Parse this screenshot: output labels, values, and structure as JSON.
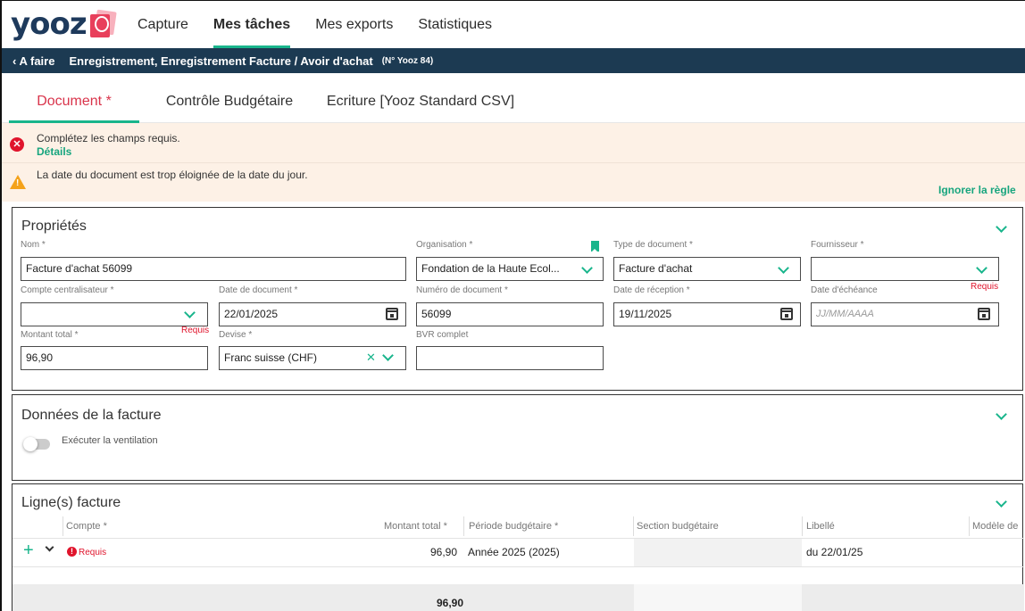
{
  "app": {
    "logo_text": "yooz",
    "nav": [
      {
        "label": "Capture",
        "active": false
      },
      {
        "label": "Mes tâches",
        "active": true
      },
      {
        "label": "Mes exports",
        "active": false
      },
      {
        "label": "Statistiques",
        "active": false
      }
    ]
  },
  "breadcrumb": {
    "back_label": "A faire",
    "title": "Enregistrement, Enregistrement Facture / Avoir d'achat",
    "doc_number": "(N° Yooz 84)"
  },
  "tabs": [
    {
      "label": "Document *",
      "active": true
    },
    {
      "label": "Contrôle Budgétaire",
      "active": false
    },
    {
      "label": "Ecriture [Yooz Standard CSV]",
      "active": false
    }
  ],
  "alerts": {
    "error_text": "Complétez les champs requis.",
    "error_link": "Détails",
    "warning_text": "La date du document est trop éloignée de la date du jour.",
    "warning_action": "Ignorer la règle"
  },
  "properties": {
    "title": "Propriétés",
    "nom": {
      "label": "Nom *",
      "value": "Facture d'achat 56099"
    },
    "organisation": {
      "label": "Organisation *",
      "value": "Fondation de la Haute Ecol..."
    },
    "type_document": {
      "label": "Type de document *",
      "value": "Facture d'achat"
    },
    "fournisseur": {
      "label": "Fournisseur *",
      "value": "",
      "requis": "Requis"
    },
    "compte_centralisateur": {
      "label": "Compte centralisateur *",
      "value": "",
      "requis": "Requis"
    },
    "date_document": {
      "label": "Date de document *",
      "value": "22/01/2025"
    },
    "numero_document": {
      "label": "Numéro de document *",
      "value": "56099"
    },
    "date_reception": {
      "label": "Date de réception *",
      "value": "19/11/2025"
    },
    "date_echeance": {
      "label": "Date d'échéance",
      "placeholder": "JJ/MM/AAAA"
    },
    "montant_total": {
      "label": "Montant total *",
      "value": "96,90"
    },
    "devise": {
      "label": "Devise *",
      "value": "Franc suisse (CHF)"
    },
    "bvr": {
      "label": "BVR complet",
      "value": ""
    }
  },
  "invoice_data": {
    "title": "Données de la facture",
    "toggle_label": "Exécuter la ventilation"
  },
  "lines": {
    "title": "Ligne(s) facture",
    "columns": [
      "Compte *",
      "Montant total *",
      "Période budgétaire *",
      "Section budgétaire",
      "Libellé",
      "Modèle de"
    ],
    "row": {
      "compte": "Requis",
      "montant": "96,90",
      "periode": "Année 2025 (2025)",
      "section": "",
      "libelle": "du 22/01/25"
    },
    "total": "96,90"
  },
  "colors": {
    "accent": "#19b58c",
    "brand_dark": "#1c3a52",
    "error": "#e0142c",
    "warning": "#f4a21a",
    "tab_active": "#d9344b"
  }
}
